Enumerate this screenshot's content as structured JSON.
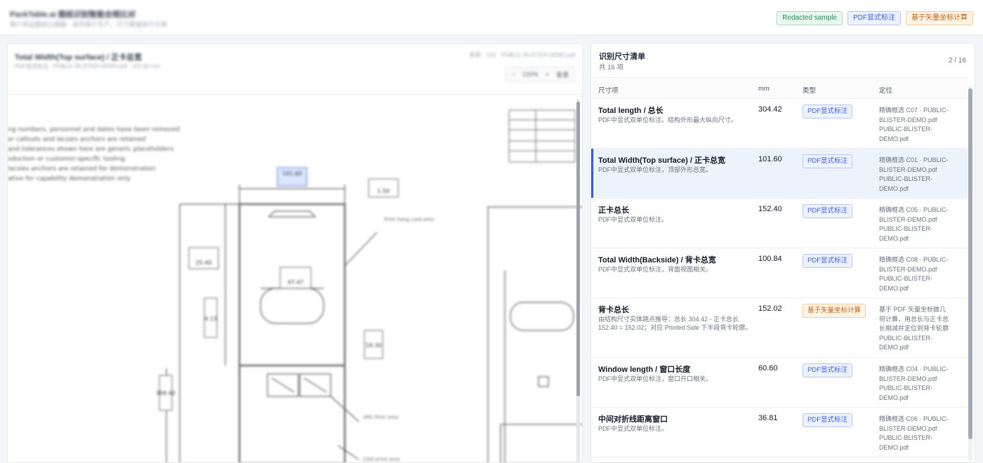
{
  "header": {
    "title": "PackTable.ai 图纸识别智能合规比对",
    "subtitle": "客户样品图纸已脱敏 · 请勿用于生产，尺寸数值用于示意",
    "chips": [
      {
        "label": "Redacted sample",
        "color": "#2f8a55"
      },
      {
        "label": "PDF显式标注",
        "color": "#3b5bdb"
      },
      {
        "label": "基于矢量坐标计算",
        "color": "#c2620c"
      }
    ]
  },
  "viewer": {
    "title": "Total Width(Top surface) / 正卡总宽",
    "subtitle": "PDF显式标注 · PUBLIC-BLISTER-DEMO.pdf · 101.60 mm",
    "right_meta": "来源：C01 · PUBLIC-BLISTER-DEMO.pdf",
    "zoom_minus": "−",
    "zoom_level": "100%",
    "zoom_plus": "+",
    "zoom_reset": "重置",
    "notes": [
      "ng numbers, personnel and dates have been removed",
      "er callouts and lacsies anchors are retained",
      "and tolerances shown here are generic placeholders",
      "oduction or customer-specific tooling",
      "lacsies anchors are retained for demonstration",
      "ative for capability demonstration only"
    ],
    "dims": [
      "304.42",
      "101.60",
      "1.50",
      "25.40",
      "47.47",
      "4.13",
      "18.30",
      "1.50"
    ],
    "drawing_labels": [
      "Print hang card area",
      "UPC Print area",
      "COO print area"
    ]
  },
  "panel": {
    "title": "识别尺寸清单",
    "count": "共 16 项",
    "page": "2 / 16",
    "columns": {
      "name": "尺寸项",
      "value": "mm",
      "type": "类型",
      "location": "定位"
    },
    "rows": [
      {
        "name": "Total length / 总长",
        "desc": "PDF中显式双单位标注。结构外形最大纵向尺寸。",
        "value": "304.42",
        "type": "PDF显式标注",
        "type_kind": "blue",
        "location": "精确框选 C07 · PUBLIC-BLISTER-DEMO.pdf PUBLIC-BLISTER-DEMO.pdf",
        "selected": false
      },
      {
        "name": "Total Width(Top surface) / 正卡总宽",
        "desc": "PDF中显式双单位标注，顶部外形总宽。",
        "value": "101.60",
        "type": "PDF显式标注",
        "type_kind": "blue",
        "location": "精确框选 C01 · PUBLIC-BLISTER-DEMO.pdf PUBLIC-BLISTER-DEMO.pdf",
        "selected": true
      },
      {
        "name": "正卡总长",
        "desc": "PDF中显式双单位标注。",
        "value": "152.40",
        "type": "PDF显式标注",
        "type_kind": "blue",
        "location": "精确框选 C05 · PUBLIC-BLISTER-DEMO.pdf PUBLIC-BLISTER-DEMO.pdf",
        "selected": false
      },
      {
        "name": "Total Width(Backside) / 背卡总宽",
        "desc": "PDF中显式双单位标注，背面视图相关。",
        "value": "100.84",
        "type": "PDF显式标注",
        "type_kind": "blue",
        "location": "精确框选 C08 · PUBLIC-BLISTER-DEMO.pdf PUBLIC-BLISTER-DEMO.pdf",
        "selected": false
      },
      {
        "name": "背卡总长",
        "desc": "由结构尺寸实体跳点推导：总长 304.42 - 正卡总长 152.40 = 152.02；对应 Printed Side 下半段背卡轮廓。",
        "value": "152.02",
        "type": "基于矢量坐标计算",
        "type_kind": "orange",
        "location": "基于 PDF 矢量坐标做几何计算，用总长与正卡总长相减并定位到背卡轮廓 PUBLIC-BLISTER-DEMO.pdf",
        "selected": false
      },
      {
        "name": "Window length / 窗口长度",
        "desc": "PDF中显式双单位标注，窗口开口相关。",
        "value": "60.60",
        "type": "PDF显式标注",
        "type_kind": "blue",
        "location": "精确框选 C04 · PUBLIC-BLISTER-DEMO.pdf PUBLIC-BLISTER-DEMO.pdf",
        "selected": false
      },
      {
        "name": "中间对折线距离窗口",
        "desc": "PDF中显式双单位标注。",
        "value": "36.81",
        "type": "PDF显式标注",
        "type_kind": "blue",
        "location": "精确框选 C06 · PUBLIC-BLISTER-DEMO.pdf PUBLIC-BLISTER-DEMO.pdf",
        "selected": false
      }
    ]
  }
}
